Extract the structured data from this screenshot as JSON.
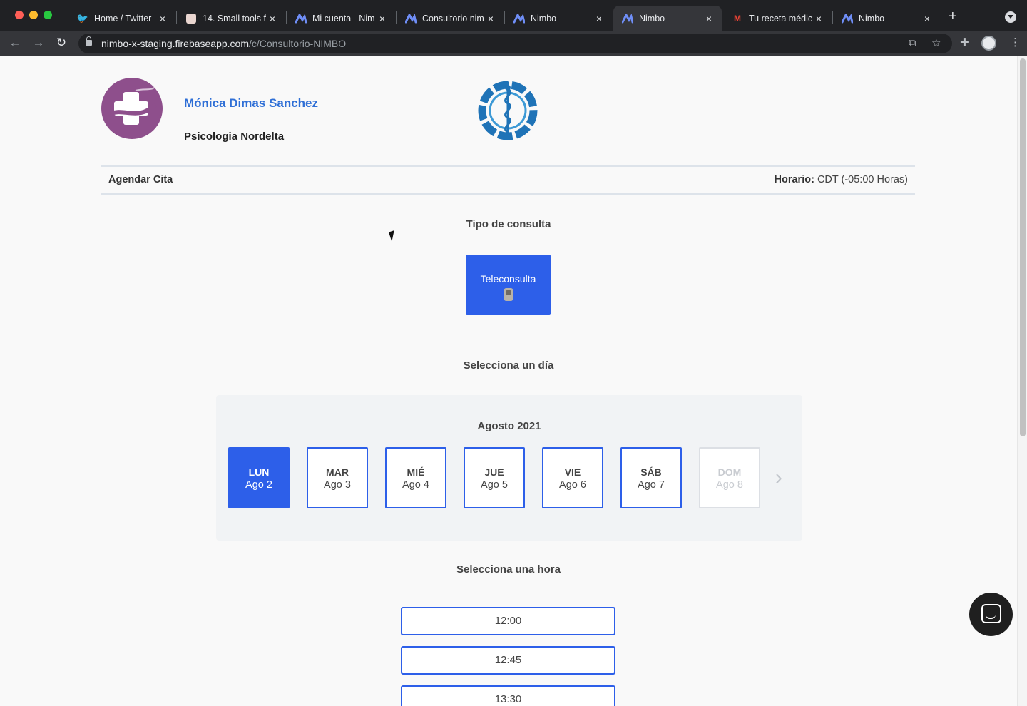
{
  "browser": {
    "tabs": [
      {
        "label": "Home / Twitter",
        "icon": "twitter-icon",
        "active": false
      },
      {
        "label": "14. Small tools f",
        "icon": "favicon-icon",
        "active": false
      },
      {
        "label": "Mi cuenta - Nim",
        "icon": "nimbo-icon",
        "active": false
      },
      {
        "label": "Consultorio nim",
        "icon": "nimbo-icon",
        "active": false
      },
      {
        "label": "Nimbo",
        "icon": "nimbo-icon",
        "active": false
      },
      {
        "label": "Nimbo",
        "icon": "nimbo-icon",
        "active": true
      },
      {
        "label": "Tu receta médic",
        "icon": "gmail-icon",
        "active": false
      },
      {
        "label": "Nimbo",
        "icon": "nimbo-icon",
        "active": false
      }
    ],
    "url_host": "nimbo-x-staging.firebaseapp.com",
    "url_path": "/c/Consultorio-NIMBO"
  },
  "header": {
    "doctor_name": "Mónica Dimas Sanchez",
    "clinic_name": "Psicologia Nordelta"
  },
  "bar": {
    "left_label": "Agendar Cita",
    "horario_label": "Horario:",
    "horario_value": "CDT (-05:00 Horas)"
  },
  "consult": {
    "title": "Tipo de consulta",
    "option_label": "Teleconsulta"
  },
  "day_picker": {
    "title": "Selecciona un día",
    "month": "Agosto 2021",
    "days": [
      {
        "dow": "LUN",
        "date": "Ago 2",
        "state": "selected"
      },
      {
        "dow": "MAR",
        "date": "Ago 3",
        "state": "available"
      },
      {
        "dow": "MIÉ",
        "date": "Ago 4",
        "state": "available"
      },
      {
        "dow": "JUE",
        "date": "Ago 5",
        "state": "available"
      },
      {
        "dow": "VIE",
        "date": "Ago 6",
        "state": "available"
      },
      {
        "dow": "SÁB",
        "date": "Ago 7",
        "state": "available"
      },
      {
        "dow": "DOM",
        "date": "Ago 8",
        "state": "disabled"
      }
    ]
  },
  "time_picker": {
    "title": "Selecciona una hora",
    "slots": [
      "12:00",
      "12:45",
      "13:30"
    ]
  },
  "colors": {
    "accent": "#2d5fe9",
    "brand_purple": "#8e4f8c",
    "brand_blue": "#1f73b7"
  }
}
